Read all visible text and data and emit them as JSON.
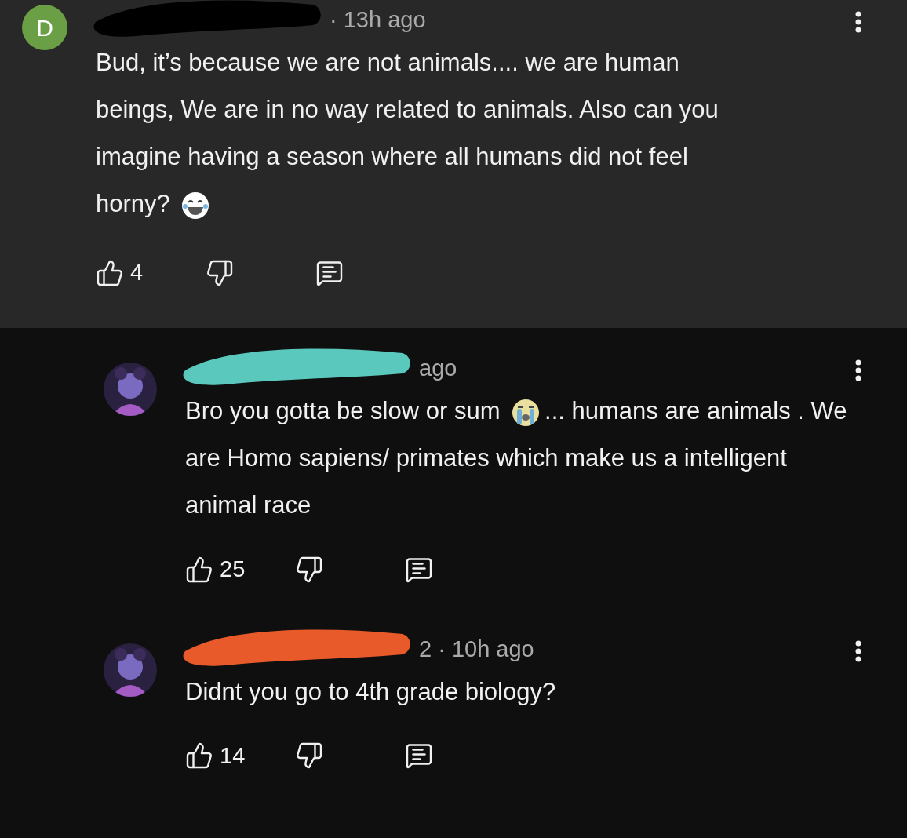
{
  "comments": [
    {
      "kind": "top",
      "avatar": {
        "kind": "letter",
        "letter": "D",
        "color": "#6a9f45"
      },
      "meta": "· 13h ago",
      "scribble": {
        "color": "#000000"
      },
      "body": [
        {
          "kind": "text",
          "text": "Bud, it’s because we are not animals.... we are human beings, We are in no way related to animals. Also can you imagine having a season where all humans did not feel horny?"
        },
        {
          "kind": "laughing"
        }
      ],
      "likes": "4"
    },
    {
      "kind": "reply",
      "avatar": {
        "kind": "picture"
      },
      "meta": "ago",
      "scribble": {
        "color": "#5bc8bd"
      },
      "body": [
        {
          "kind": "text",
          "text": "Bro you gotta be slow or sum"
        },
        {
          "kind": "crying"
        },
        {
          "kind": "text",
          "text": "... humans are animals . We are Homo sapiens/ primates which make us a intelligent animal race"
        }
      ],
      "likes": "25"
    },
    {
      "kind": "reply",
      "avatar": {
        "kind": "picture"
      },
      "meta": "2 · 10h ago",
      "scribble": {
        "color": "#e85a2a"
      },
      "body": [
        {
          "kind": "text",
          "text": "Didnt you go to 4th grade biology?"
        }
      ],
      "likes": "14"
    }
  ]
}
